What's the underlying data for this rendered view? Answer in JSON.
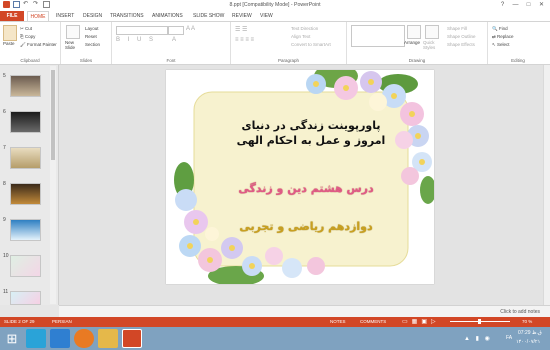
{
  "window": {
    "title": "8.ppt [Compatibility Mode] - PowerPoint",
    "controls": [
      "?",
      "—",
      "□",
      "✕"
    ]
  },
  "tabs": [
    "FILE",
    "HOME",
    "INSERT",
    "DESIGN",
    "TRANSITIONS",
    "ANIMATIONS",
    "SLIDE SHOW",
    "REVIEW",
    "VIEW"
  ],
  "ribbon": {
    "clipboard": {
      "paste": "Paste",
      "cut": "Cut",
      "copy": "Copy",
      "format_painter": "Format Painter",
      "label": "Clipboard"
    },
    "slides": {
      "new_slide": "New Slide",
      "layout": "Layout",
      "reset": "Reset",
      "section": "Section",
      "label": "Slides"
    },
    "font": {
      "label": "Font"
    },
    "paragraph": {
      "text_direction": "Text Direction",
      "align_text": "Align Text",
      "smartart": "Convert to SmartArt",
      "label": "Paragraph"
    },
    "drawing": {
      "arrange": "Arrange",
      "quick_styles": "Quick Styles",
      "shape_fill": "Shape Fill",
      "shape_outline": "Shape Outline",
      "shape_effects": "Shape Effects",
      "label": "Drawing"
    },
    "editing": {
      "find": "Find",
      "replace": "Replace",
      "select": "Select",
      "label": "Editing"
    }
  },
  "thumbnails": [
    {
      "num": "5",
      "colors": [
        "#6b5b4f",
        "#c9b79a"
      ]
    },
    {
      "num": "6",
      "colors": [
        "#1b1b1b",
        "#6a6a6a"
      ]
    },
    {
      "num": "7",
      "colors": [
        "#e8dcc0",
        "#b59d6a"
      ]
    },
    {
      "num": "8",
      "colors": [
        "#3b2a1a",
        "#c28a3a"
      ]
    },
    {
      "num": "9",
      "colors": [
        "#2e7fc2",
        "#e4f2fb"
      ]
    },
    {
      "num": "10",
      "colors": [
        "#dfefe3",
        "#f3d6e6"
      ]
    },
    {
      "num": "11",
      "colors": [
        "#d7f0f5",
        "#f6d0e4"
      ]
    }
  ],
  "slide": {
    "title_line1": "پاورپوینت زندگی در دنیای",
    "title_line2": "امروز و عمل به احکام الهی",
    "subtitle": "درس هشتم دین و زندگی",
    "grade": "دوازدهم ریاضی و تجربی"
  },
  "notes_hint": "Click to add notes",
  "status": {
    "slide_count": "SLIDE 2 OF 29",
    "language": "PERSIAN",
    "notes": "NOTES",
    "comments": "COMMENTS",
    "zoom": "70 %"
  },
  "taskbar": {
    "lang": "FA",
    "time": "07:29 ق.ظ",
    "date": "۱۴۰۰/۰۷/۲۱"
  }
}
